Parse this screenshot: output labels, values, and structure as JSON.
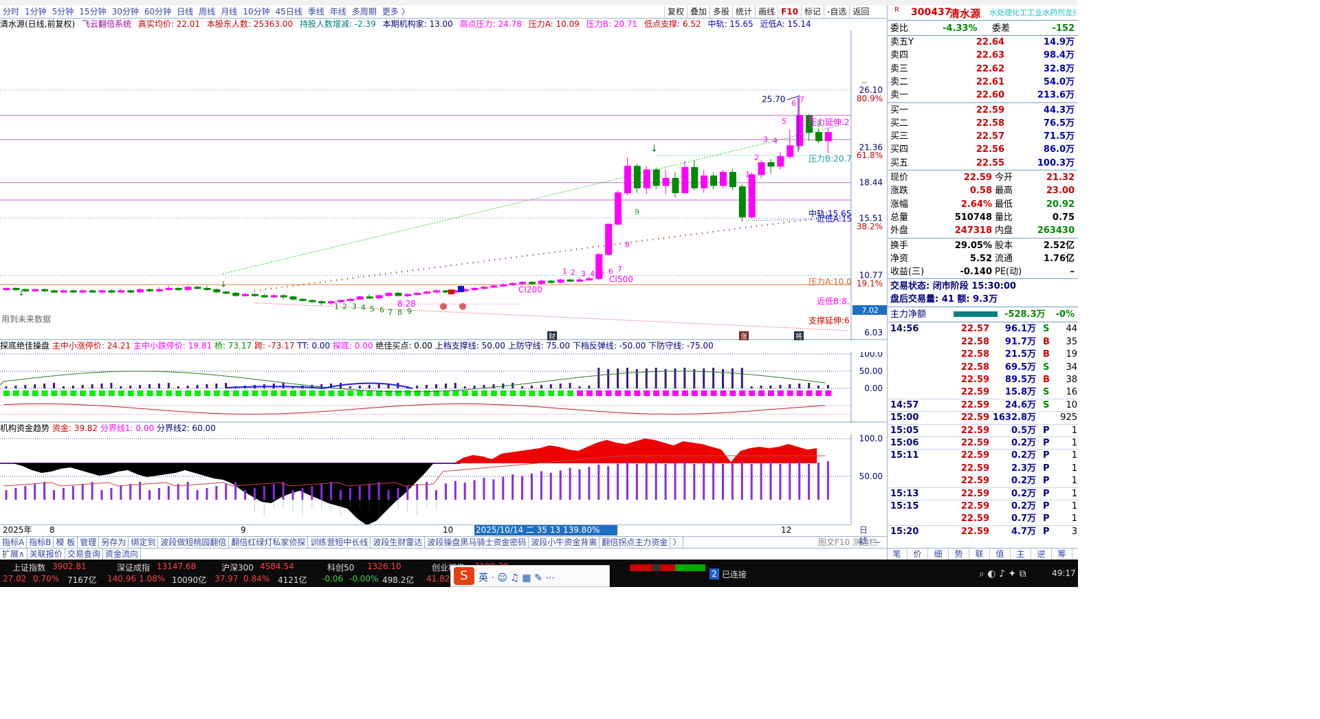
{
  "menu": [
    "分时",
    "1分钟",
    "5分钟",
    "15分钟",
    "30分钟",
    "60分钟",
    "日线",
    "周线",
    "月线",
    "10分钟",
    "45日线",
    "季线",
    "年线",
    "多周期",
    "更多 〉"
  ],
  "right_tools": [
    "复权",
    "叠加",
    "多股",
    "统计",
    "画线",
    "F10",
    "标记",
    "-自选",
    "返回"
  ],
  "kinfo": {
    "name": "清水源(日线,前复权)",
    "system": "飞云翻倍系统",
    "real_cost": "真实均价: 22.01",
    "holders": "本股东人数: 25363.00",
    "holders_chg": "持股人数增减: -2.39",
    "inst": "本期机构家: 13.00",
    "high_pressure": "高点压力: 24.78",
    "pressA": "压力A: 10.09",
    "pressB": "压力B: 20.71",
    "low_support": "低点支撑: 6.52",
    "mid": "中轨: 15.65",
    "nearlow": "近低A: 15.14"
  },
  "price_axis": [
    "26.10",
    "80.9%",
    "21.36",
    "61.8%",
    "18.44",
    "15.51",
    "38.2%",
    "10.77",
    "19.1%",
    "6.03"
  ],
  "price_tag": "7.02",
  "chart_labels": {
    "peak": "25.70",
    "stretch": "压力延伸:2",
    "pressB": "压力B:20.7",
    "midline": "中轨:15.65",
    "nearlowA": "近低A:15",
    "pressA": "压力A:10.0",
    "nearlowB": "近低B:8.",
    "support": "支撑延伸:6",
    "low": "8.28",
    "ci200": "CI200",
    "ci500": "CI500",
    "future": "用到未来数据",
    "badge_cai": "财",
    "badge_zhang": "涨",
    "badge_jiang": "将"
  },
  "sub1": {
    "name": "探底绝佳操盘",
    "a": "主中小涨停价: 24.21",
    "b": "主中小跌停价: 19.81",
    "c": "桥: 73.17",
    "d": "跨: -73.17",
    "e": "TT: 0.00",
    "f": "探底: 0.00",
    "g": "绝佳买点: 0.00",
    "h": "上档支撑线: 50.00",
    "i": "上防守线: 75.00",
    "j": "下档反弹线: -50.00",
    "k": "下防守线: -75.00",
    "axis": [
      "100.0",
      "50.00",
      "0.00"
    ]
  },
  "sub2": {
    "name": "机构资金趋势",
    "a": "资金: 39.82",
    "b": "分界线1: 0.00",
    "c": "分界线2: 60.00",
    "axis": [
      "100.0",
      "50.00"
    ]
  },
  "dates": {
    "y": "2025年",
    "m8": "8",
    "m9": "9",
    "m10": "10",
    "sel": "2025/10/14 二 35 13 139.80%",
    "m12": "12",
    "period": "日线"
  },
  "tabs1": [
    "指标A",
    "指标B",
    "模 板",
    "管理",
    "另存为",
    "绑定到",
    "波段做短桃园翻倍",
    "翻倍红绿灯私家侦探",
    "训练营短中长线",
    "波段生财雷达",
    "波段操盘黑马骑士资金密码",
    "波段小牛资金背离",
    "翻倍拐点主力资金",
    "〉"
  ],
  "tabs2": [
    "扩展∧",
    "关联报价",
    "交易查询",
    "资金流向"
  ],
  "stock": {
    "code": "300437",
    "name": "清水源",
    "tag": "R",
    "scroll": "水处理化工工业水药剂龙头"
  },
  "ratio": {
    "l": "委比",
    "v": "-4.33%",
    "l2": "委差",
    "v2": "-152"
  },
  "asks": [
    [
      "卖五Y",
      "22.64",
      "14.9万"
    ],
    [
      "卖四",
      "22.63",
      "98.4万"
    ],
    [
      "卖三",
      "22.62",
      "32.8万"
    ],
    [
      "卖二",
      "22.61",
      "54.0万"
    ],
    [
      "卖一",
      "22.60",
      "213.6万"
    ]
  ],
  "bids": [
    [
      "买一",
      "22.59",
      "44.3万"
    ],
    [
      "买二",
      "22.58",
      "76.5万"
    ],
    [
      "买三",
      "22.57",
      "71.5万"
    ],
    [
      "买四",
      "22.56",
      "86.0万"
    ],
    [
      "买五",
      "22.55",
      "100.3万"
    ]
  ],
  "quote": [
    [
      "现价",
      "22.59",
      "今开",
      "21.32"
    ],
    [
      "涨跌",
      "0.58",
      "最高",
      "23.00"
    ],
    [
      "涨幅",
      "2.64%",
      "最低",
      "20.92"
    ],
    [
      "总量",
      "510748",
      "量比",
      "0.75"
    ],
    [
      "外盘",
      "247318",
      "内盘",
      "263430"
    ]
  ],
  "quote2": [
    [
      "换手",
      "29.05%",
      "股本",
      "2.52亿"
    ],
    [
      "净资",
      "5.52",
      "流通",
      "1.76亿"
    ],
    [
      "收益(三)",
      "-0.140",
      "PE(动)",
      "–"
    ]
  ],
  "status": {
    "state": "交易状态: 闭市阶段 15:30:00",
    "after": "盘后交易量: 41 额: 9.3万"
  },
  "mainflow": {
    "label": "主力净额",
    "value": "-528.3万",
    "pct": "-0%"
  },
  "ticks": [
    [
      "14:56",
      "22.57",
      "96.1万",
      "S",
      "44"
    ],
    [
      "",
      "22.58",
      "91.7万",
      "B",
      "35"
    ],
    [
      "",
      "22.58",
      "21.5万",
      "B",
      "19"
    ],
    [
      "",
      "22.58",
      "69.5万",
      "S",
      "34"
    ],
    [
      "",
      "22.59",
      "89.5万",
      "B",
      "38"
    ],
    [
      "",
      "22.59",
      "15.8万",
      "S",
      "16"
    ],
    [
      "14:57",
      "22.59",
      "24.6万",
      "S",
      "10"
    ],
    [
      "15:00",
      "22.59",
      "1632.8万",
      "",
      "925"
    ],
    [
      "15:05",
      "22.59",
      "0.5万",
      "P",
      "1"
    ],
    [
      "15:06",
      "22.59",
      "0.2万",
      "P",
      "1"
    ],
    [
      "15:11",
      "22.59",
      "0.2万",
      "P",
      "1"
    ],
    [
      "",
      "22.59",
      "2.3万",
      "P",
      "1"
    ],
    [
      "",
      "22.59",
      "0.2万",
      "P",
      "1"
    ],
    [
      "15:13",
      "22.59",
      "0.2万",
      "P",
      "1"
    ],
    [
      "15:15",
      "22.59",
      "0.2万",
      "P",
      "1"
    ],
    [
      "",
      "22.59",
      "0.7万",
      "P",
      "1"
    ],
    [
      "15:20",
      "22.59",
      "4.7万",
      "P",
      "3"
    ]
  ],
  "side_tabs": [
    "笔",
    "价",
    "细",
    "势",
    "联",
    "值",
    "主",
    "逆",
    "筹"
  ],
  "side_top": [
    "图文F10",
    "测边栏"
  ],
  "bottom": {
    "sh": "上证指数",
    "sh_v": "3902.81",
    "sh_c": "27.02",
    "sh_p": "0.70%",
    "sh_a": "7167亿",
    "sz": "深证成指",
    "sz_v": "13147.68",
    "sz_c": "140.96",
    "sz_p": "1.08%",
    "sz_a": "10090亿",
    "hs": "沪深300",
    "hs_v": "4584.54",
    "hs_c": "37.97",
    "hs_p": "0.84%",
    "hs_a": "4121亿",
    "kc": "科创50",
    "kc_v": "1326.10",
    "kc_c": "-0.06",
    "kc_p": "-0.00%",
    "kc_a": "498.2亿",
    "cy": "创业板指",
    "cy_v": "3109.39",
    "cy_c": "41.82",
    "conn": "已连接",
    "conn_n": "2",
    "time": "49:17"
  },
  "colors": {
    "up": "#ff00ff",
    "down": "#008800",
    "accent": "#d00000"
  }
}
